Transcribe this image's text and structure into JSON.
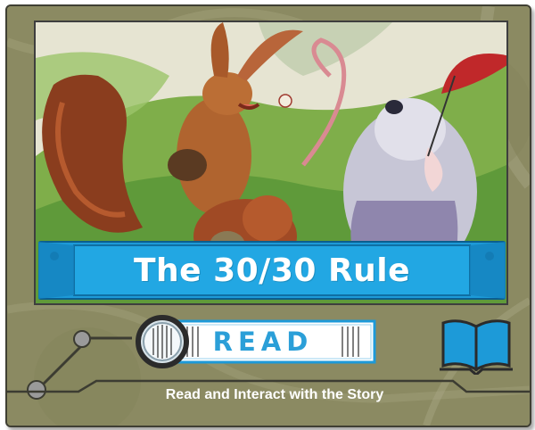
{
  "story": {
    "title": "The 30/30 Rule"
  },
  "read_button": {
    "label": "READ"
  },
  "subtitle": "Read and Interact with the Story",
  "icons": {
    "magnifier": "magnifier-icon",
    "book": "open-book-icon"
  },
  "colors": {
    "frame": "#8c8a62",
    "banner": "#1d9ad8",
    "banner_dark": "#0b6fa4",
    "read_text": "#2b9fd8"
  }
}
